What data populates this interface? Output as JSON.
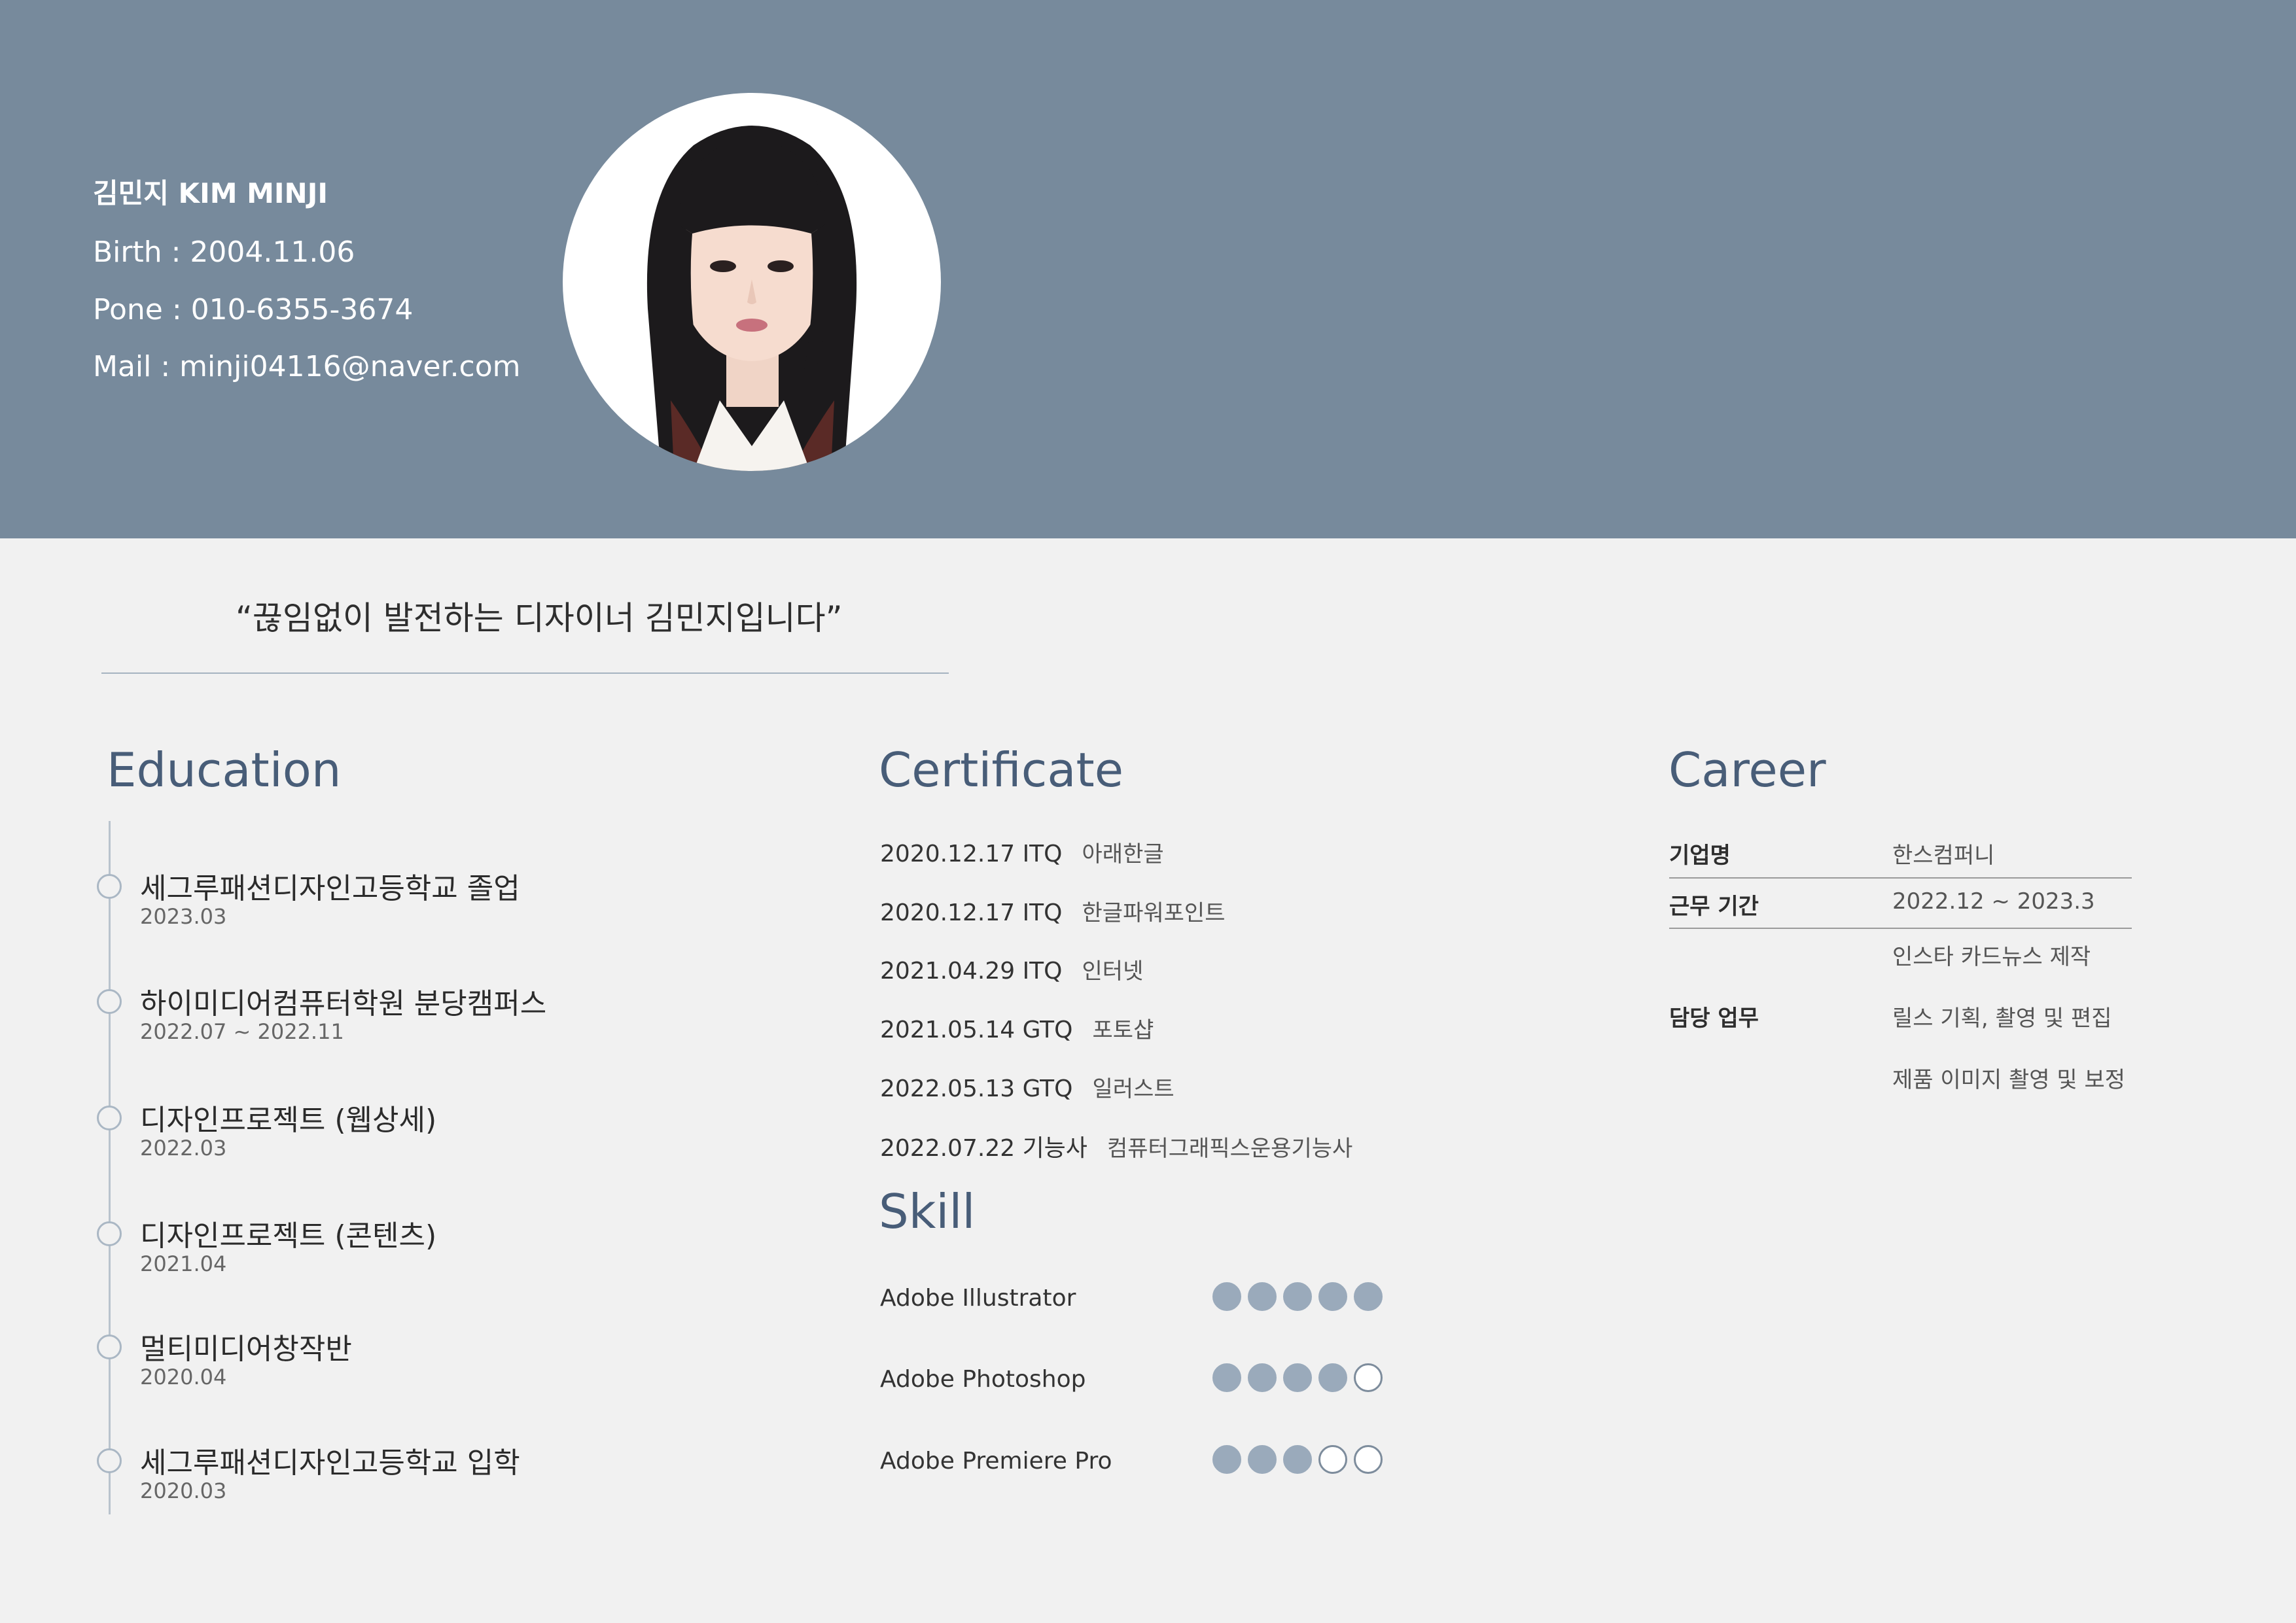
{
  "profile": {
    "name": "김민지 KIM MINJI",
    "birth": "Birth : 2004.11.06",
    "phone": "Pone : 010-6355-3674",
    "mail": "Mail : minji04116@naver.com",
    "photo": "portrait-photo"
  },
  "quote": "“끊임없이 발전하는 디자이너 김민지입니다”",
  "education": {
    "title": "Education",
    "items": [
      {
        "name": "세그루패션디자인고등학교 졸업",
        "date": "2023.03"
      },
      {
        "name": "하이미디어컴퓨터학원 분당캠퍼스",
        "date": "2022.07 ~ 2022.11"
      },
      {
        "name": "디자인프로젝트 (웹상세)",
        "date": "2022.03"
      },
      {
        "name": "디자인프로젝트 (콘텐츠)",
        "date": "2021.04"
      },
      {
        "name": "멀티미디어창작반",
        "date": "2020.04"
      },
      {
        "name": "세그루패션디자인고등학교 입학",
        "date": "2020.03"
      }
    ]
  },
  "certificate": {
    "title": "Certificate",
    "items": [
      {
        "date": "2020.12.17 ITQ",
        "name": "아래한글"
      },
      {
        "date": "2020.12.17 ITQ",
        "name": "한글파워포인트"
      },
      {
        "date": "2021.04.29 ITQ",
        "name": "인터넷"
      },
      {
        "date": "2021.05.14 GTQ",
        "name": "포토샵"
      },
      {
        "date": "2022.05.13 GTQ",
        "name": "일러스트"
      },
      {
        "date": "2022.07.22 기능사",
        "name": "컴퓨터그래픽스운용기능사"
      }
    ]
  },
  "skill": {
    "title": "Skill",
    "items": [
      {
        "name": "Adobe Illustrator",
        "level": 5,
        "max": 5
      },
      {
        "name": "Adobe Photoshop",
        "level": 4,
        "max": 5
      },
      {
        "name": "Adobe Premiere Pro",
        "level": 3,
        "max": 5
      }
    ]
  },
  "career": {
    "title": "Career",
    "company_label": "기업명",
    "company_value": "한스컴퍼니",
    "period_label": "근무 기간",
    "period_value": "2022.12 ~ 2023.3",
    "duty_label": "담당 업무",
    "duties": [
      "인스타 카드뉴스 제작",
      "릴스 기획, 촬영 및 편집",
      "제품 이미지 촬영 및 보정"
    ]
  },
  "colors": {
    "header_bg": "#778a9c",
    "page_bg": "#f1f1f1",
    "title_color": "#485d78",
    "dot_filled": "#9aaabb"
  }
}
